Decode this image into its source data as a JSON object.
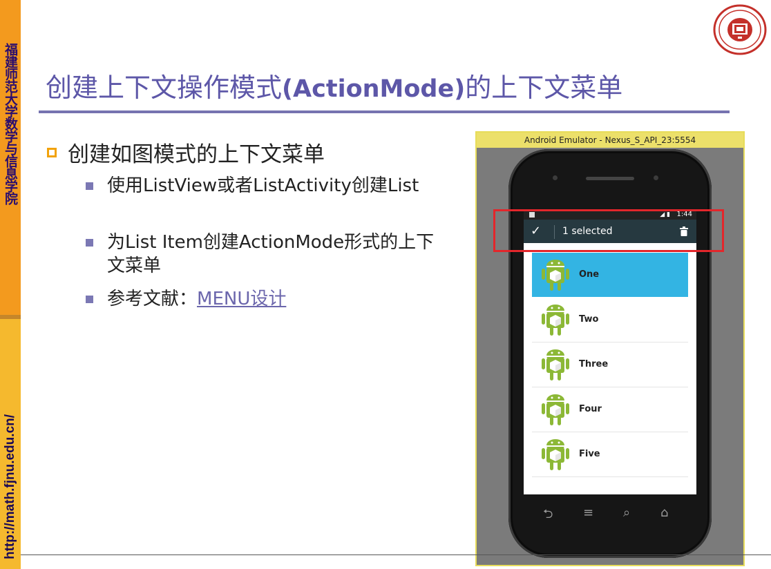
{
  "sidebar": {
    "school_name": "福建师范大学数学与信息学院",
    "url": "http://math.fjnu.edu.cn/"
  },
  "slide": {
    "title_prefix": "创建上下文操作模式",
    "title_bold": "(ActionMode)",
    "title_suffix": "的上下文菜单",
    "main_bullet": "创建如图模式的上下文菜单",
    "sub_bullets": [
      {
        "text": "使用ListView或者ListActivity创建List"
      },
      {
        "text": "为List Item创建ActionMode形式的上下文菜单"
      },
      {
        "prefix": "参考文献：",
        "link": "MENU设计"
      }
    ]
  },
  "emulator": {
    "window_title": "Android Emulator - Nexus_S_API_23:5554",
    "status_time": "1:44",
    "action_bar_text": "1 selected",
    "list_items": [
      "One",
      "Two",
      "Three",
      "Four",
      "Five"
    ],
    "selected_index": 0
  },
  "colors": {
    "title": "#5d57a8",
    "band_orange": "#f39a1e",
    "selected_item": "#33b4e3",
    "action_bar": "#263940",
    "highlight_box": "#e3262b",
    "android_green": "#8cb836"
  },
  "icons": [
    "logo-seal",
    "checkmark-icon",
    "trash-icon",
    "android-icon",
    "back-icon",
    "menu-icon",
    "search-icon",
    "home-icon"
  ]
}
